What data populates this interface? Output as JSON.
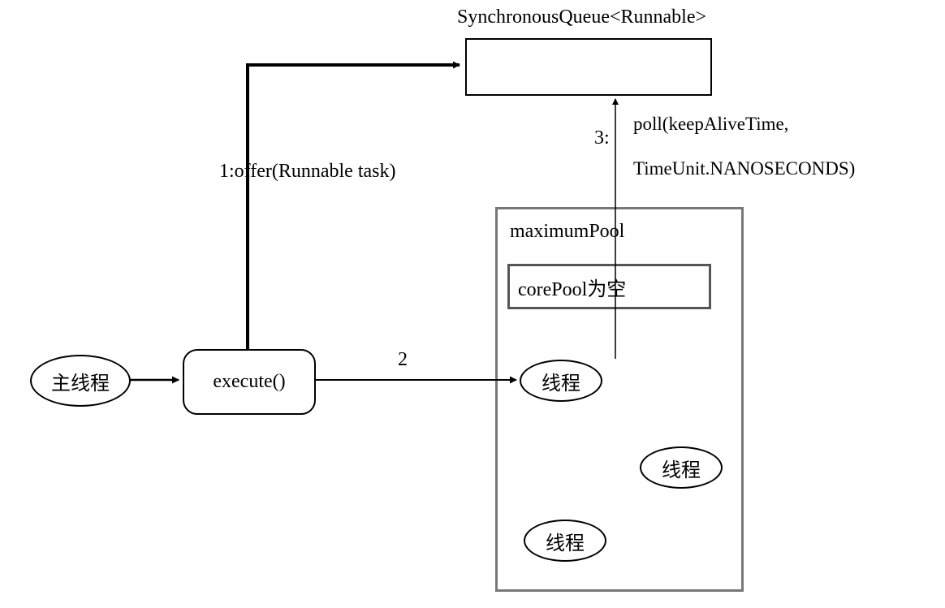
{
  "diagram": {
    "queue": {
      "title": "SynchronousQueue<Runnable>"
    },
    "mainThread": {
      "label": "主线程"
    },
    "execute": {
      "label": "execute()"
    },
    "arrows": {
      "offer": "1:offer(Runnable task)",
      "two": "2",
      "three": "3:",
      "poll_line1": "poll(keepAliveTime,",
      "poll_line2": "TimeUnit.NANOSECONDS)"
    },
    "pool": {
      "title": "maximumPool",
      "corePool": "corePool为空",
      "thread1": "线程",
      "thread2": "线程",
      "thread3": "线程"
    }
  }
}
